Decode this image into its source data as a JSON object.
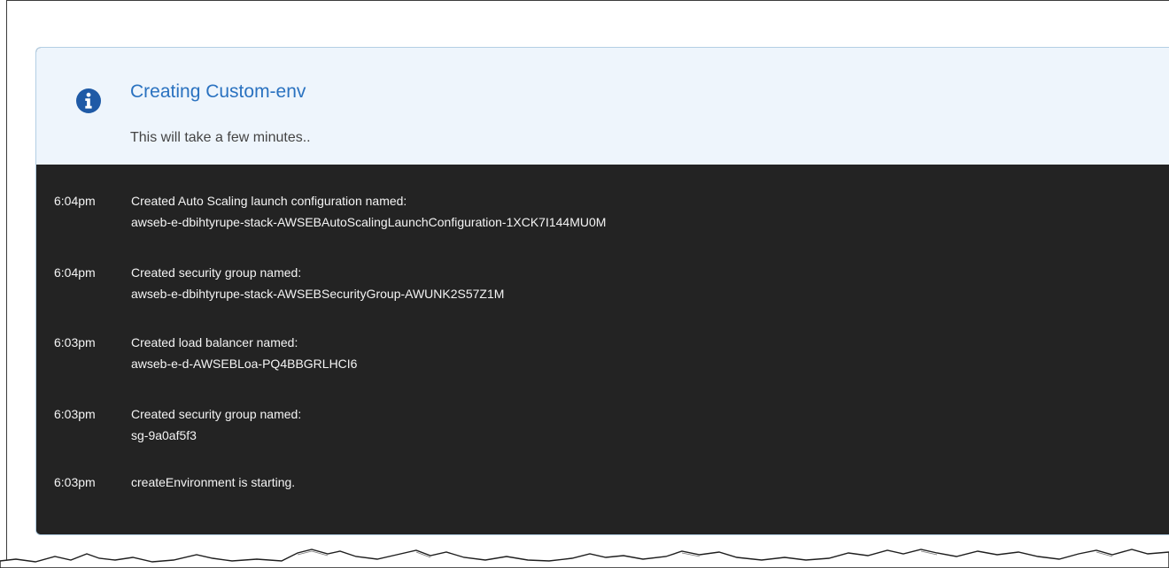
{
  "header": {
    "title": "Creating Custom-env",
    "subtitle": "This will take a few minutes.."
  },
  "icons": {
    "info": "info-icon"
  },
  "colors": {
    "title": "#2a72c0",
    "header_bg": "#eef5fc",
    "log_bg": "#232323",
    "log_text": "#f4f4f4"
  },
  "events": [
    {
      "time": "6:04pm",
      "message": "Created Auto Scaling launch configuration named:",
      "name": "awseb-e-dbihtyrupe-stack-AWSEBAutoScalingLaunchConfiguration-1XCK7I144MU0M"
    },
    {
      "time": "6:04pm",
      "message": "Created security group named:",
      "name": "awseb-e-dbihtyrupe-stack-AWSEBSecurityGroup-AWUNK2S57Z1M"
    },
    {
      "time": "6:03pm",
      "message": "Created load balancer named:",
      "name": "awseb-e-d-AWSEBLoa-PQ4BBGRLHCI6"
    },
    {
      "time": "6:03pm",
      "message": "Created security group named:",
      "name": "sg-9a0af5f3"
    },
    {
      "time": "6:03pm",
      "message": "createEnvironment is starting."
    }
  ]
}
